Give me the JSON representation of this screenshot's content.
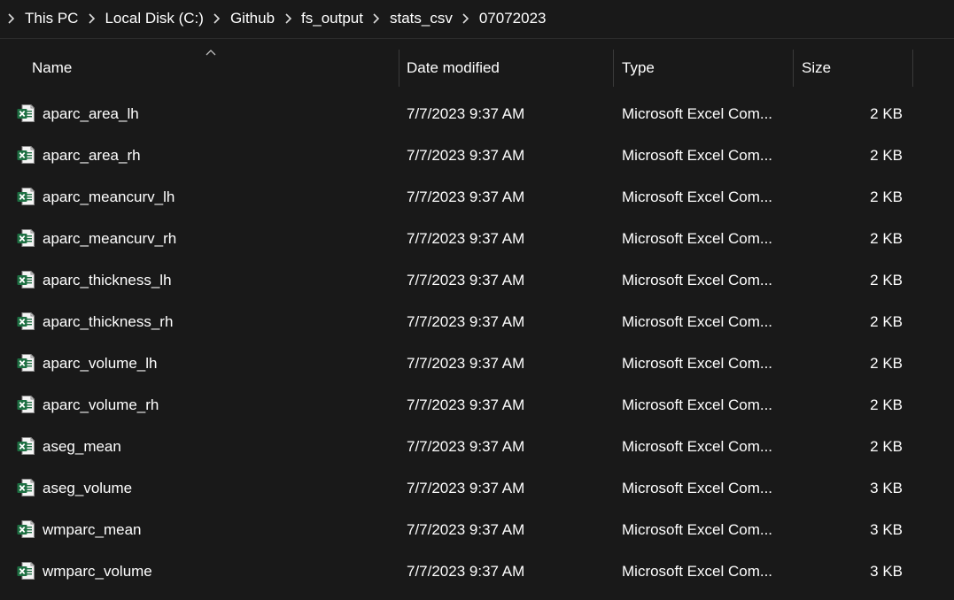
{
  "breadcrumb": {
    "items": [
      "This PC",
      "Local Disk (C:)",
      "Github",
      "fs_output",
      "stats_csv",
      "07072023"
    ]
  },
  "columns": {
    "name": "Name",
    "date_modified": "Date modified",
    "type": "Type",
    "size": "Size",
    "sort_indicator": "chevron-up-icon"
  },
  "files": [
    {
      "name": "aparc_area_lh",
      "date": "7/7/2023 9:37 AM",
      "type": "Microsoft Excel Com...",
      "size": "2 KB"
    },
    {
      "name": "aparc_area_rh",
      "date": "7/7/2023 9:37 AM",
      "type": "Microsoft Excel Com...",
      "size": "2 KB"
    },
    {
      "name": "aparc_meancurv_lh",
      "date": "7/7/2023 9:37 AM",
      "type": "Microsoft Excel Com...",
      "size": "2 KB"
    },
    {
      "name": "aparc_meancurv_rh",
      "date": "7/7/2023 9:37 AM",
      "type": "Microsoft Excel Com...",
      "size": "2 KB"
    },
    {
      "name": "aparc_thickness_lh",
      "date": "7/7/2023 9:37 AM",
      "type": "Microsoft Excel Com...",
      "size": "2 KB"
    },
    {
      "name": "aparc_thickness_rh",
      "date": "7/7/2023 9:37 AM",
      "type": "Microsoft Excel Com...",
      "size": "2 KB"
    },
    {
      "name": "aparc_volume_lh",
      "date": "7/7/2023 9:37 AM",
      "type": "Microsoft Excel Com...",
      "size": "2 KB"
    },
    {
      "name": "aparc_volume_rh",
      "date": "7/7/2023 9:37 AM",
      "type": "Microsoft Excel Com...",
      "size": "2 KB"
    },
    {
      "name": "aseg_mean",
      "date": "7/7/2023 9:37 AM",
      "type": "Microsoft Excel Com...",
      "size": "2 KB"
    },
    {
      "name": "aseg_volume",
      "date": "7/7/2023 9:37 AM",
      "type": "Microsoft Excel Com...",
      "size": "3 KB"
    },
    {
      "name": "wmparc_mean",
      "date": "7/7/2023 9:37 AM",
      "type": "Microsoft Excel Com...",
      "size": "3 KB"
    },
    {
      "name": "wmparc_volume",
      "date": "7/7/2023 9:37 AM",
      "type": "Microsoft Excel Com...",
      "size": "3 KB"
    }
  ],
  "icons": {
    "breadcrumb_separator": "chevron-right-icon",
    "file": "excel-csv-file-icon"
  },
  "colors": {
    "background": "#191919",
    "text": "#ffffff",
    "excel_green": "#1d6f42"
  }
}
